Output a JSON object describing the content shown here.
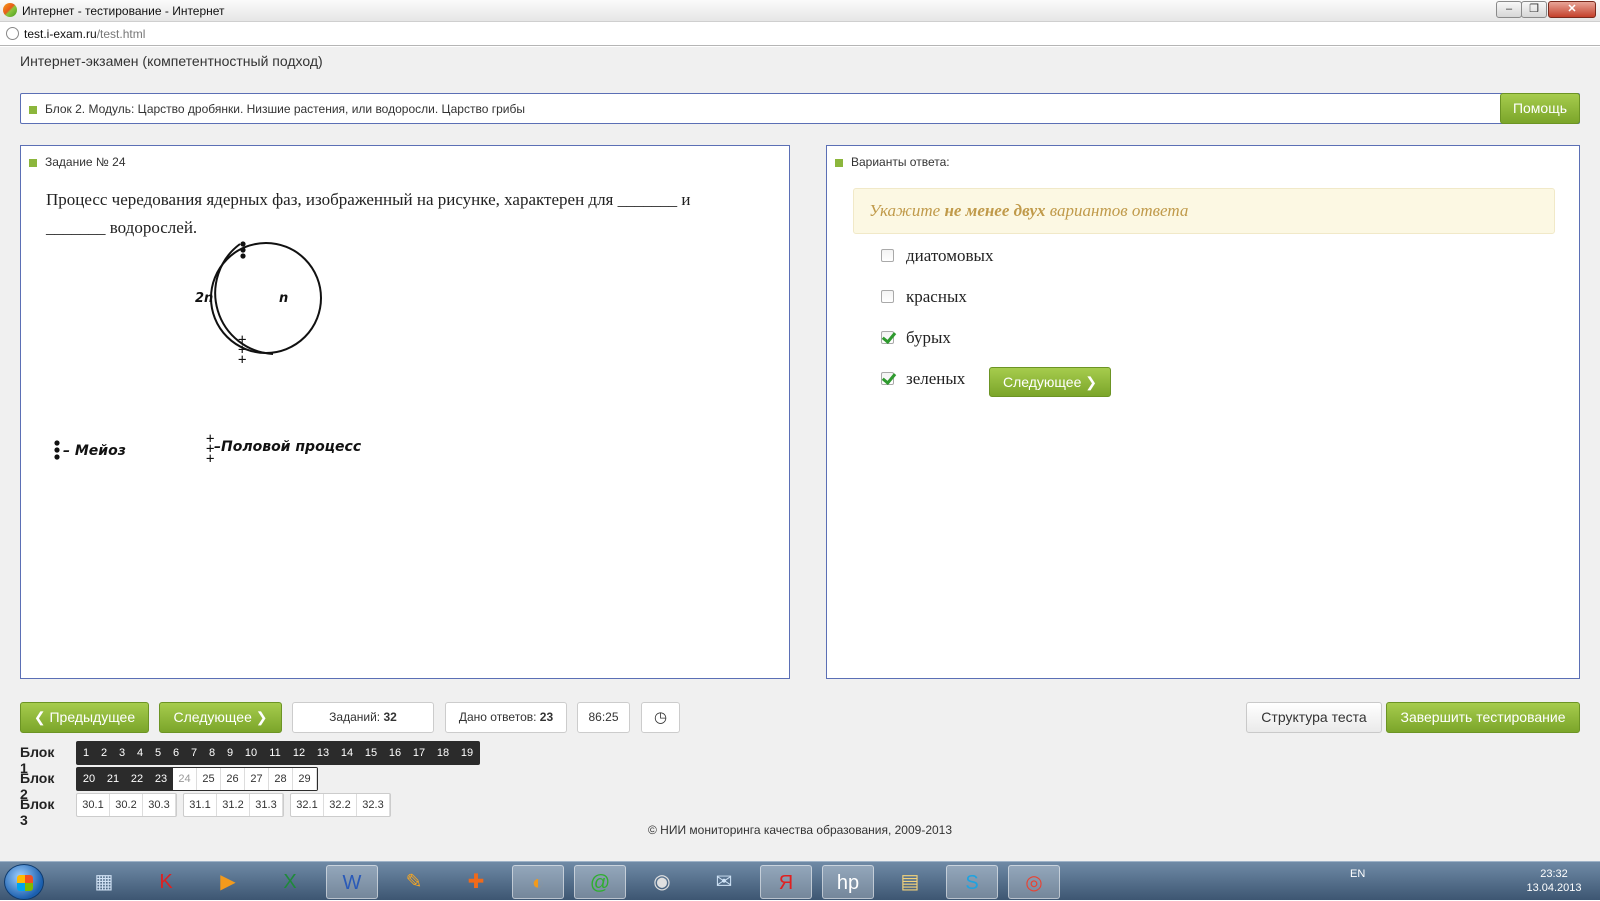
{
  "window": {
    "title": "Интернет - тестирование - Интернет"
  },
  "address": {
    "host": "test.i-exam.ru",
    "path": "/test.html"
  },
  "exam": {
    "title": "Интернет-экзамен (компетентностный подход)"
  },
  "block_header": {
    "text": "Блок 2. Модуль: Царство дробянки. Низшие растения, или водоросли. Царство грибы",
    "help_label": "Помощь"
  },
  "task": {
    "header": "Задание № 24",
    "question": "Процесс чередования ядерных фаз, изображенный на рисунке, характерен для _______ и _______ водорослей.",
    "figure": {
      "label_left": "2n",
      "label_right": "n",
      "legend_meiosis": "– Мейоз",
      "legend_sex": "–Половой   процесс"
    }
  },
  "answers": {
    "header": "Варианты ответа:",
    "hint_pre": "Укажите ",
    "hint_bold": "не менее двух",
    "hint_post": " вариантов ответа",
    "options": [
      {
        "label": "диатомовых",
        "checked": false
      },
      {
        "label": "красных",
        "checked": false
      },
      {
        "label": "бурых",
        "checked": true
      },
      {
        "label": "зеленых",
        "checked": true
      }
    ],
    "next_label": "Следующее"
  },
  "nav": {
    "prev_label": "Предыдущее",
    "next_label": "Следующее",
    "tasks_label": "Заданий:",
    "tasks_count": "32",
    "answered_label": "Дано ответов:",
    "answered_count": "23",
    "timer": "86:25",
    "structure_label": "Структура теста",
    "finish_label": "Завершить тестирование"
  },
  "blocks": [
    {
      "label": "Блок 1",
      "groups": [
        {
          "dark": true,
          "cells": [
            "1",
            "2",
            "3",
            "4",
            "5",
            "6",
            "7",
            "8",
            "9",
            "10",
            "11",
            "12",
            "13",
            "14",
            "15",
            "16",
            "17",
            "18",
            "19"
          ]
        }
      ]
    },
    {
      "label": "Блок 2",
      "groups": [
        {
          "dark": true,
          "cells": [
            "20",
            "21",
            "22",
            "23"
          ]
        },
        {
          "dark": false,
          "cells": [
            "24",
            "25",
            "26",
            "27",
            "28",
            "29"
          ],
          "current": "24",
          "attached": true
        }
      ]
    },
    {
      "label": "Блок 3",
      "groups": [
        {
          "dark": false,
          "cells": [
            "30.1",
            "30.2",
            "30.3"
          ]
        },
        {
          "dark": false,
          "cells": [
            "31.1",
            "31.2",
            "31.3"
          ]
        },
        {
          "dark": false,
          "cells": [
            "32.1",
            "32.2",
            "32.3"
          ]
        }
      ]
    }
  ],
  "footer": "© НИИ мониторинга качества образования, 2009-2013",
  "taskbar": {
    "icons": [
      "calculator-icon",
      "kaspersky-icon",
      "media-player-icon",
      "excel-icon",
      "word-icon",
      "draw-icon",
      "paint-icon",
      "ie-exam-icon",
      "mail-agent-icon",
      "radio-icon",
      "outlook-icon",
      "yandex-icon",
      "hp-icon",
      "explorer-icon",
      "skype-icon",
      "chrome-icon"
    ],
    "lang": "EN",
    "time": "23:32",
    "date": "13.04.2013"
  }
}
